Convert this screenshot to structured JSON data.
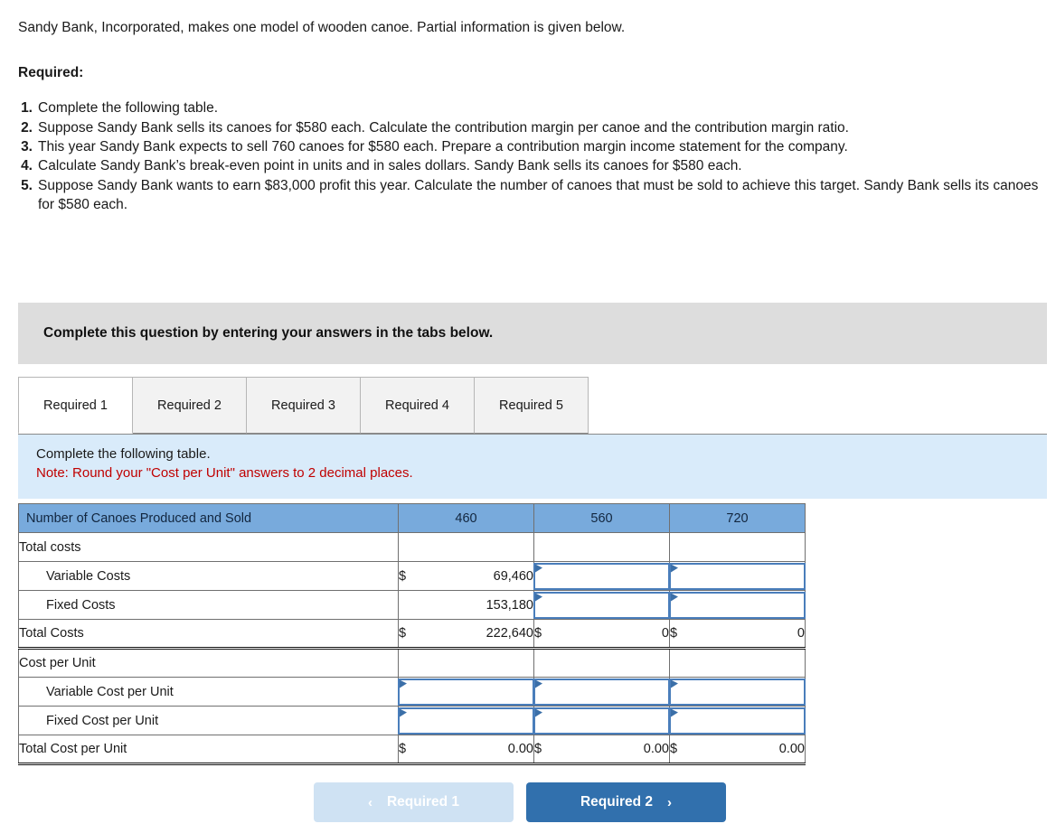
{
  "intro": {
    "paragraph": "Sandy Bank, Incorporated, makes one model of wooden canoe. Partial information is given below.",
    "required_heading": "Required:",
    "requirements": [
      {
        "num": "1.",
        "text": "Complete the following table."
      },
      {
        "num": "2.",
        "text": "Suppose Sandy Bank sells its canoes for $580 each. Calculate the contribution margin per canoe and the contribution margin ratio."
      },
      {
        "num": "3.",
        "text": "This year Sandy Bank expects to sell 760 canoes for $580 each. Prepare a contribution margin income statement for the company."
      },
      {
        "num": "4.",
        "text": "Calculate Sandy Bank’s break-even point in units and in sales dollars. Sandy Bank sells its canoes for $580 each."
      },
      {
        "num": "5.",
        "text": "Suppose Sandy Bank wants to earn $83,000 profit this year. Calculate the number of canoes that must be sold to achieve this target. Sandy Bank sells its canoes for $580 each."
      }
    ]
  },
  "banner": {
    "text": "Complete this question by entering your answers in the tabs below."
  },
  "tabs": {
    "items": [
      {
        "label": "Required 1",
        "active": true
      },
      {
        "label": "Required 2",
        "active": false
      },
      {
        "label": "Required 3",
        "active": false
      },
      {
        "label": "Required 4",
        "active": false
      },
      {
        "label": "Required 5",
        "active": false
      }
    ]
  },
  "note": {
    "line1": "Complete the following table.",
    "line2": "Note: Round your \"Cost per Unit\" answers to 2 decimal places."
  },
  "table": {
    "header": {
      "row_label": "Number of Canoes Produced and Sold",
      "columns": [
        "460",
        "560",
        "720"
      ]
    },
    "rows": [
      {
        "label": "Total costs",
        "indent": false,
        "kind": "section",
        "cells": [
          {
            "type": "blank"
          },
          {
            "type": "blank"
          },
          {
            "type": "blank"
          }
        ]
      },
      {
        "label": "Variable Costs",
        "indent": true,
        "kind": "data",
        "cells": [
          {
            "type": "money",
            "symbol": "$",
            "value": "69,460"
          },
          {
            "type": "input",
            "value": ""
          },
          {
            "type": "input",
            "value": ""
          }
        ]
      },
      {
        "label": "Fixed Costs",
        "indent": true,
        "kind": "data",
        "cells": [
          {
            "type": "number",
            "value": "153,180"
          },
          {
            "type": "input",
            "value": ""
          },
          {
            "type": "input",
            "value": ""
          }
        ]
      },
      {
        "label": "Total Costs",
        "indent": false,
        "kind": "total",
        "cells": [
          {
            "type": "money",
            "symbol": "$",
            "value": "222,640"
          },
          {
            "type": "money",
            "symbol": "$",
            "value": "0"
          },
          {
            "type": "money",
            "symbol": "$",
            "value": "0"
          }
        ]
      },
      {
        "label": "Cost per Unit",
        "indent": false,
        "kind": "section",
        "cells": [
          {
            "type": "blank"
          },
          {
            "type": "blank"
          },
          {
            "type": "blank"
          }
        ]
      },
      {
        "label": "Variable Cost per Unit",
        "indent": true,
        "kind": "data",
        "cells": [
          {
            "type": "input",
            "value": ""
          },
          {
            "type": "input",
            "value": ""
          },
          {
            "type": "input",
            "value": ""
          }
        ]
      },
      {
        "label": "Fixed Cost per Unit",
        "indent": true,
        "kind": "data",
        "cells": [
          {
            "type": "input",
            "value": ""
          },
          {
            "type": "input",
            "value": ""
          },
          {
            "type": "input",
            "value": ""
          }
        ]
      },
      {
        "label": "Total Cost per Unit",
        "indent": false,
        "kind": "total",
        "cells": [
          {
            "type": "money",
            "symbol": "$",
            "value": "0.00"
          },
          {
            "type": "money",
            "symbol": "$",
            "value": "0.00"
          },
          {
            "type": "money",
            "symbol": "$",
            "value": "0.00"
          }
        ]
      }
    ]
  },
  "nav": {
    "prev_label": "Required 1",
    "prev_chevron": "‹",
    "next_label": "Required 2",
    "next_chevron": "›"
  },
  "colors": {
    "header_blue": "#78aadc",
    "note_blue": "#d9ebfa",
    "banner_gray": "#dddddd",
    "note_red": "#c00000",
    "input_border": "#4a7ebb",
    "btn_next": "#3170ad",
    "btn_prev": "#cfe2f3"
  }
}
